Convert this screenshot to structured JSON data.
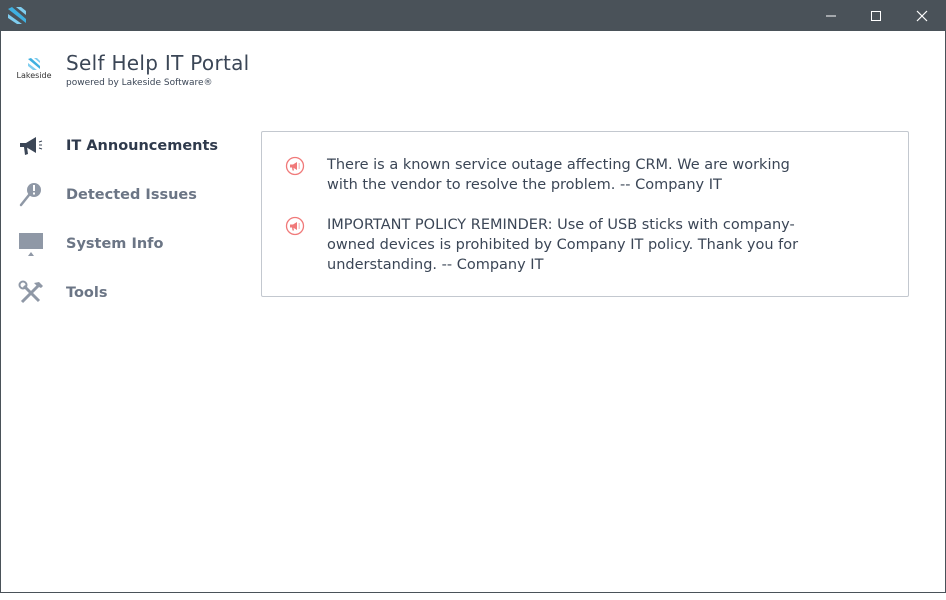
{
  "window": {
    "controls": {
      "minimize": "minimize",
      "maximize": "maximize",
      "close": "close"
    }
  },
  "header": {
    "logo_text": "Lakeside",
    "title": "Self Help IT Portal",
    "subtitle": "powered by Lakeside Software®"
  },
  "sidebar": {
    "items": [
      {
        "label": "IT Announcements",
        "icon": "megaphone-icon",
        "active": true
      },
      {
        "label": "Detected Issues",
        "icon": "magnifier-alert-icon",
        "active": false
      },
      {
        "label": "System Info",
        "icon": "monitor-icon",
        "active": false
      },
      {
        "label": "Tools",
        "icon": "tools-icon",
        "active": false
      }
    ]
  },
  "announcements": [
    {
      "icon": "megaphone-icon",
      "text": "There is a known service outage affecting CRM. We are working with the vendor to resolve the problem. -- Company IT"
    },
    {
      "icon": "megaphone-icon",
      "text": "IMPORTANT POLICY REMINDER: Use of USB sticks with company-owned devices is prohibited by Company IT policy. Thank you for understanding. -- Company IT"
    }
  ],
  "colors": {
    "titlebar": "#4a5259",
    "accent_blue": "#3fb0e0",
    "announcement_icon": "#f07a7a",
    "text_dark": "#3b4656"
  }
}
